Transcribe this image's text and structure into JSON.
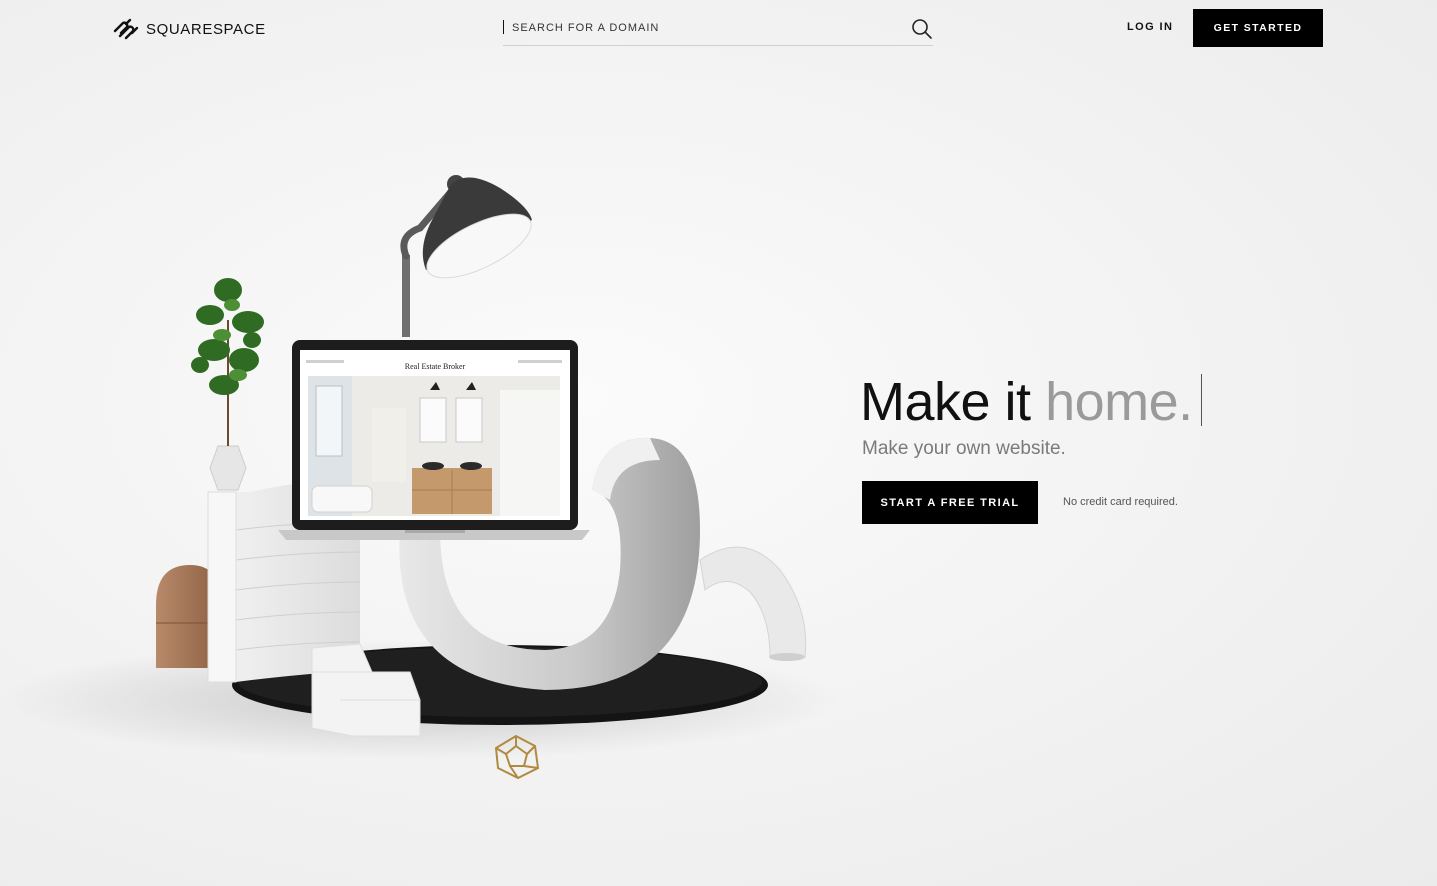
{
  "header": {
    "logo_text": "SQUARESPACE",
    "search_placeholder": "SEARCH FOR A DOMAIN",
    "login_label": "LOG IN",
    "get_started_label": "GET STARTED"
  },
  "hero": {
    "title_dark": "Make it ",
    "title_light": "home.",
    "subtitle": "Make your own website.",
    "cta_label": "START A FREE TRIAL",
    "cta_note": "No credit card required."
  },
  "illustration": {
    "laptop_site_title": "Real Estate Broker"
  },
  "colors": {
    "primary_button": "#000000",
    "title_dark": "#111111",
    "title_light": "#9a9a9a",
    "subtitle": "#7a7a7a"
  },
  "icons": {
    "logo": "squarespace-logo-icon",
    "search": "search-icon"
  }
}
